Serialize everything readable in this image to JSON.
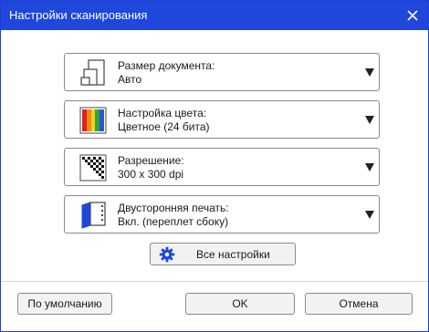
{
  "window": {
    "title": "Настройки сканирования"
  },
  "settings": [
    {
      "label": "Размер документа:",
      "value": "Авто",
      "icon": "document-size-icon"
    },
    {
      "label": "Настройка цвета:",
      "value": "Цветное (24 бита)",
      "icon": "color-bars-icon"
    },
    {
      "label": "Разрешение:",
      "value": "300 x 300 dpi",
      "icon": "resolution-icon"
    },
    {
      "label": "Двусторонняя печать:",
      "value": "Вкл. (переплет сбоку)",
      "icon": "duplex-book-icon"
    }
  ],
  "all_settings": {
    "label": "Все настройки",
    "icon": "gear-icon"
  },
  "footer": {
    "default_label": "По умолчанию",
    "ok_label": "OK",
    "cancel_label": "Отмена"
  },
  "colors": {
    "titlebar": "#1f47db",
    "accent": "#1f47db"
  }
}
